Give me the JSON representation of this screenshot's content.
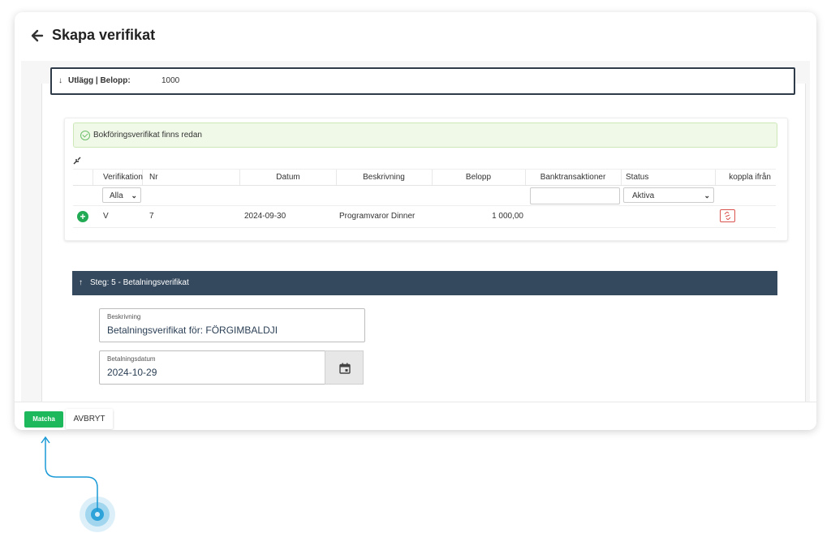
{
  "dialog": {
    "title": "Skapa verifikat"
  },
  "utlagg": {
    "arrow": "↓",
    "label": "Utlägg | Belopp:",
    "value": "1000"
  },
  "alert": {
    "text": "Bokföringsverifikat finns redan"
  },
  "table": {
    "columns": [
      "Verifikation",
      "Nr",
      "Datum",
      "Beskrivning",
      "Belopp",
      "Banktransaktioner",
      "Status",
      "koppla ifrån"
    ],
    "filters": {
      "verifikation": "Alla",
      "status": "Aktiva"
    },
    "rows": [
      {
        "verifikation": "V",
        "nr": "7",
        "datum": "2024-09-30",
        "beskrivning": "Programvaror Dinner",
        "belopp": "1 000,00"
      }
    ]
  },
  "steg": {
    "arrow": "↑",
    "label": "Steg: 5 - Betalningsverifikat"
  },
  "fields": {
    "beskrivning": {
      "label": "Beskrivning",
      "value": "Betalningsverifikat för: FÖRGIMBALDJI"
    },
    "betalningsdatum": {
      "label": "Betalningsdatum",
      "value": "2024-10-29"
    }
  },
  "footer": {
    "matcha": "Matcha",
    "avbryt": "AVBRYT"
  },
  "colors": {
    "primary_green": "#1eb85c",
    "header_dark": "#34495e",
    "alert_bg": "#f0f9e8",
    "pointer_blue": "#1a9ad6"
  },
  "icons": [
    "back-arrow-icon",
    "check-circle-icon",
    "collapse-icon",
    "add-circle-icon",
    "unlink-icon",
    "calendar-icon",
    "chevron-down-icon"
  ]
}
